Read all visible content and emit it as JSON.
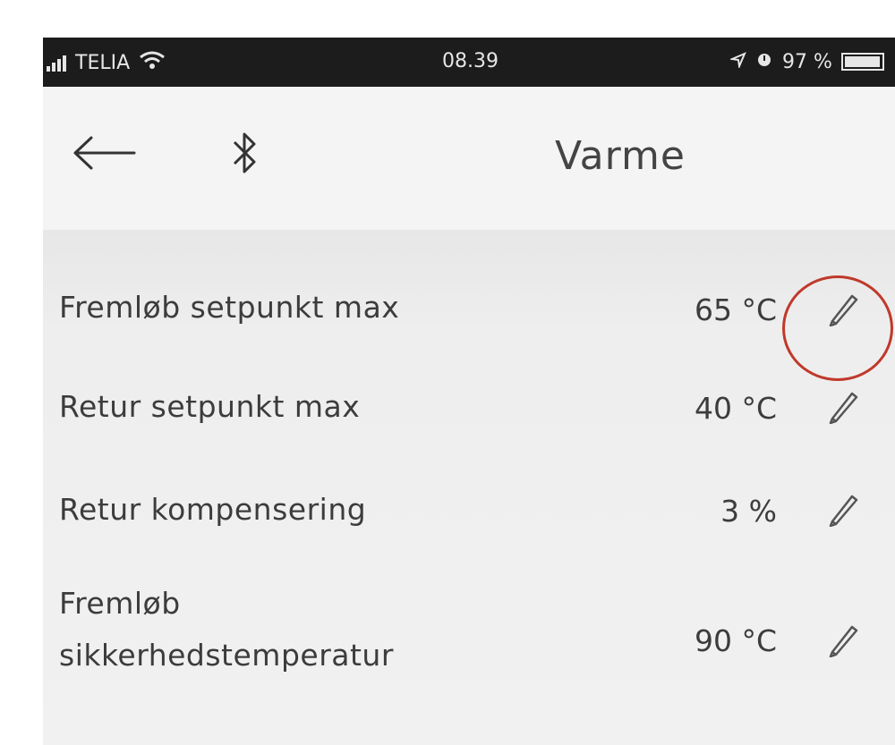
{
  "status_bar": {
    "carrier": "TELIA",
    "time": "08.39",
    "battery": "97 %",
    "battery_level": 0.97
  },
  "header": {
    "title": "Varme",
    "back_icon": "arrow-left-icon",
    "bluetooth_icon": "bluetooth-icon"
  },
  "settings": [
    {
      "label": "Fremløb setpunkt max",
      "value": "65 °C",
      "edit_icon": "pencil-icon"
    },
    {
      "label": "Retur setpunkt max",
      "value": "40 °C",
      "edit_icon": "pencil-icon"
    },
    {
      "label": "Retur kompensering",
      "value": "3 %",
      "edit_icon": "pencil-icon"
    },
    {
      "label_line1": "Fremløb",
      "label_line2": "sikkerhedstemperatur",
      "value": "90 °C",
      "edit_icon": "pencil-icon"
    }
  ],
  "colors": {
    "highlight": "#c0392b",
    "status_bar": "#1c1c1c"
  }
}
